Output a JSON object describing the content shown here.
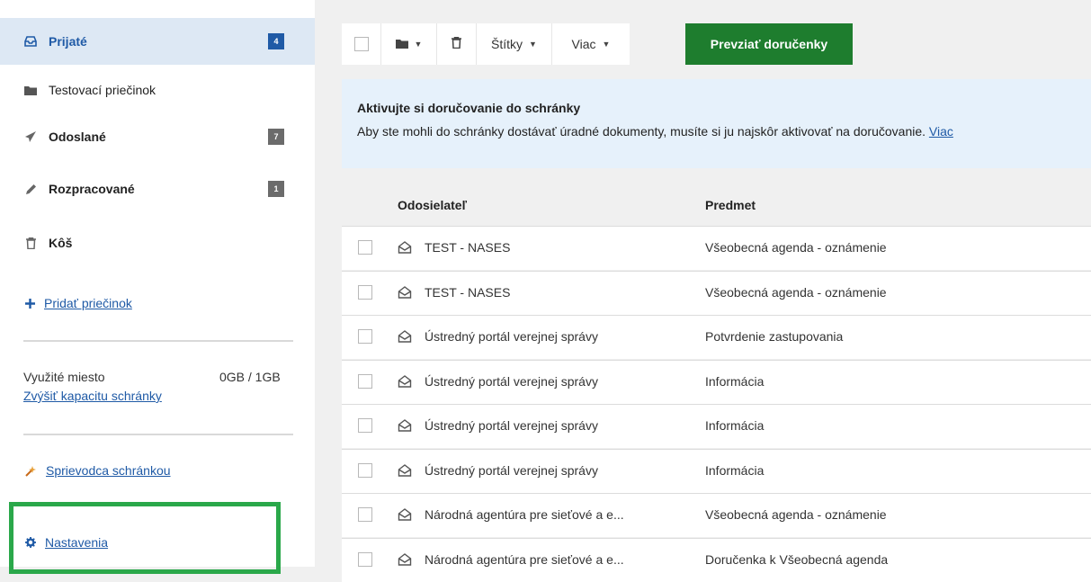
{
  "sidebar": {
    "folders": [
      {
        "label": "Prijaté",
        "count": "4",
        "icon": "inbox-icon"
      },
      {
        "label": "Testovací priečinok",
        "count": "",
        "icon": "folder-icon"
      },
      {
        "label": "Odoslané",
        "count": "7",
        "icon": "send-icon"
      },
      {
        "label": "Rozpracované",
        "count": "1",
        "icon": "pencil-icon"
      },
      {
        "label": "Kôš",
        "count": "",
        "icon": "trash-icon"
      }
    ],
    "add_folder": "Pridať priečinok",
    "storage_label": "Využité miesto",
    "storage_value": "0GB / 1GB",
    "increase_capacity": "Zvýšiť kapacitu schránky",
    "guide": "Sprievodca schránkou",
    "settings": "Nastavenia"
  },
  "toolbar": {
    "labels_button": "Štítky",
    "more_button": "Viac",
    "receive_receipts": "Prevziať doručenky"
  },
  "banner": {
    "title": "Aktivujte si doručovanie do schránky",
    "text": "Aby ste mohli do schránky dostávať úradné dokumenty, musíte si ju najskôr aktivovať na doručovanie.",
    "link": "Viac"
  },
  "table": {
    "columns": [
      "Odosielateľ",
      "Predmet"
    ],
    "rows": [
      {
        "sender": "TEST - NASES",
        "subject": "Všeobecná agenda - oznámenie"
      },
      {
        "sender": "TEST - NASES",
        "subject": "Všeobecná agenda - oznámenie"
      },
      {
        "sender": "Ústredný portál verejnej správy",
        "subject": "Potvrdenie zastupovania"
      },
      {
        "sender": "Ústredný portál verejnej správy",
        "subject": "Informácia"
      },
      {
        "sender": "Ústredný portál verejnej správy",
        "subject": "Informácia"
      },
      {
        "sender": "Ústredný portál verejnej správy",
        "subject": "Informácia"
      },
      {
        "sender": "Národná agentúra pre sieťové a e...",
        "subject": "Všeobecná agenda - oznámenie"
      },
      {
        "sender": "Národná agentúra pre sieťové a e...",
        "subject": "Doručenka k Všeobecná agenda"
      }
    ]
  },
  "colors": {
    "primary_blue": "#1f5aa6",
    "green_button": "#1e7d2e",
    "highlight_green": "#2aa84a",
    "active_folder_bg": "#dde8f4",
    "banner_bg": "#e6f1fb"
  }
}
